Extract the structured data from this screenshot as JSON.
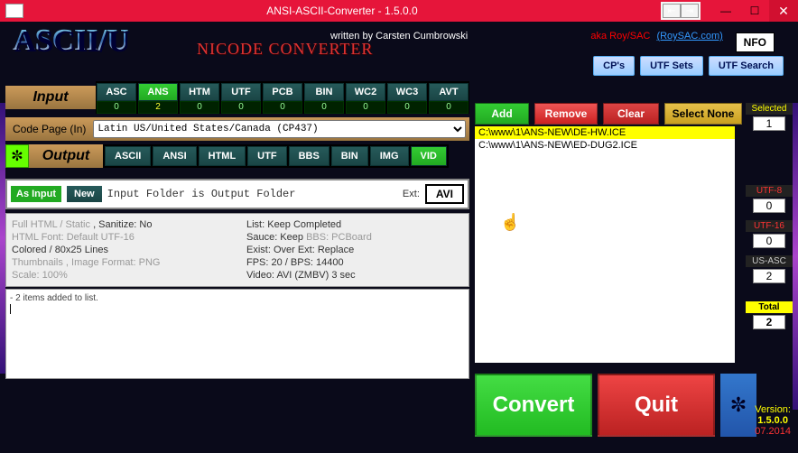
{
  "window": {
    "title": "ANSI-ASCII-Converter - 1.5.0.0"
  },
  "credits": {
    "written": "written by Carsten Cumbrowski",
    "aka": "aka Roy/SAC",
    "link": "(RoySAC.com)",
    "nfo": "NFO"
  },
  "logo": {
    "main": "ASCII/U",
    "sub": "NICODE CONVERTER"
  },
  "header_btns": {
    "cps": "CP's",
    "utfsets": "UTF Sets",
    "utfsearch": "UTF Search"
  },
  "input": {
    "label": "Input",
    "tabs": [
      {
        "name": "ASC",
        "count": "0"
      },
      {
        "name": "ANS",
        "count": "2"
      },
      {
        "name": "HTM",
        "count": "0"
      },
      {
        "name": "UTF",
        "count": "0"
      },
      {
        "name": "PCB",
        "count": "0"
      },
      {
        "name": "BIN",
        "count": "0"
      },
      {
        "name": "WC2",
        "count": "0"
      },
      {
        "name": "WC3",
        "count": "0"
      },
      {
        "name": "AVT",
        "count": "0"
      }
    ],
    "active": 1,
    "codepage_label": "Code Page (In)",
    "codepage": "Latin US/United States/Canada (CP437)"
  },
  "output": {
    "label": "Output",
    "tabs": [
      "ASCII",
      "ANSI",
      "HTML",
      "UTF",
      "BBS",
      "BIN",
      "IMG",
      "VID"
    ],
    "active": 7
  },
  "status": {
    "as_input": "As Input",
    "new": "New",
    "text": "Input Folder is Output Folder",
    "ext_label": "Ext:",
    "ext": "AVI"
  },
  "details": {
    "left": [
      {
        "t": "Full HTML   / Static ",
        "cls": "grey"
      },
      {
        "t": ", Sanitize: No",
        "cls": "dark",
        "inline": true
      },
      {
        "t": "HTML Font: Default               UTF-16",
        "cls": "grey"
      },
      {
        "t": "Colored     / 80x25 Lines",
        "cls": "dark"
      },
      {
        "t": "Thumbnails   , Image Format: PNG",
        "cls": "grey"
      },
      {
        "t": "Scale: 100%",
        "cls": "grey"
      }
    ],
    "right": [
      {
        "t": "List: Keep Completed",
        "cls": "dark"
      },
      {
        "t": "Sauce: Keep      ",
        "cls": "dark"
      },
      {
        "t": "BBS: PCBoard",
        "cls": "grey",
        "inline": true
      },
      {
        "t": "Exist: Over      Ext: Replace",
        "cls": "dark"
      },
      {
        "t": "FPS: 20 / BPS: 14400",
        "cls": "dark"
      },
      {
        "t": "Video: AVI    (ZMBV)    3 sec",
        "cls": "dark"
      }
    ]
  },
  "log": "- 2 items added to list.",
  "right_actions": {
    "add": "Add",
    "remove": "Remove",
    "clear": "Clear",
    "select_none": "Select None"
  },
  "files": {
    "items": [
      {
        "path": "C:\\www\\1\\ANS-NEW\\DE-HW.ICE",
        "selected": true
      },
      {
        "path": "C:\\www\\1\\ANS-NEW\\ED-DUG2.ICE",
        "selected": false
      }
    ]
  },
  "side": {
    "selected_label": "Selected",
    "selected": "1",
    "utf8_label": "UTF-8",
    "utf8": "0",
    "utf16_label": "UTF-16",
    "utf16": "0",
    "usasc_label": "US-ASC",
    "usasc": "2",
    "total_label": "Total",
    "total": "2"
  },
  "bottom": {
    "convert": "Convert",
    "quit": "Quit",
    "gear": "✼"
  },
  "version": {
    "label": "Version:",
    "ver": "1.5.0.0",
    "date": "07.2014"
  }
}
